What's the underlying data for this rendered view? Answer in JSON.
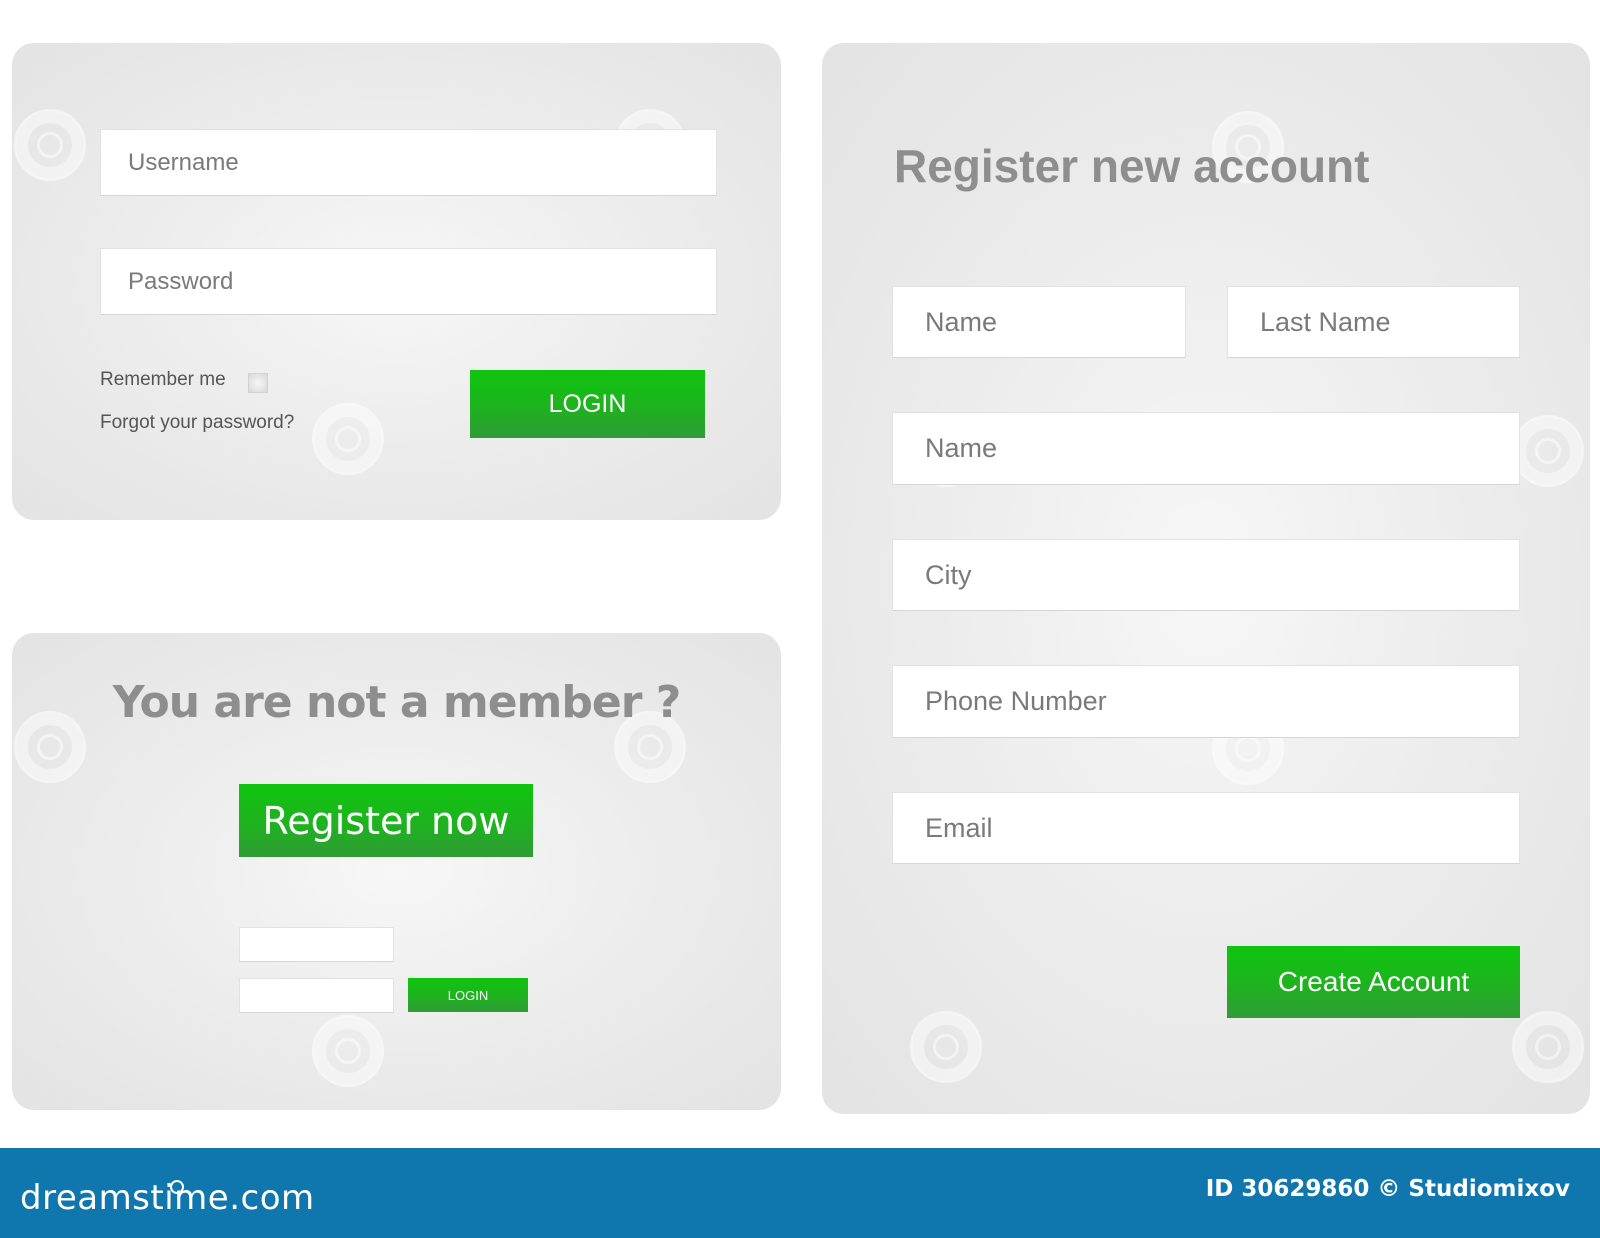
{
  "login_panel": {
    "username_placeholder": "Username",
    "password_placeholder": "Password",
    "remember_label": "Remember me",
    "remember_checked": false,
    "forgot_link": "Forgot your password?",
    "login_button": "LOGIN"
  },
  "member_panel": {
    "title": "You are not a member ?",
    "register_button": "Register now",
    "mini_username_placeholder": "",
    "mini_password_placeholder": "",
    "mini_login_button": "LOGIN"
  },
  "register_panel": {
    "title": "Register new account",
    "fields": {
      "first_name": "Name",
      "last_name": "Last Name",
      "name": "Name",
      "city": "City",
      "phone": "Phone Number",
      "email": "Email"
    },
    "create_button": "Create Account"
  },
  "footer": {
    "logo_text": "dreamstime.com",
    "credit": "ID 30629860 © Studiomixov"
  },
  "colors": {
    "accent_green": "#0ec50e",
    "accent_green_dark": "#2f9c36",
    "footer_blue": "#1076ae",
    "title_gray": "#8e8e8e",
    "panel_gray": "#e6e6e6"
  }
}
